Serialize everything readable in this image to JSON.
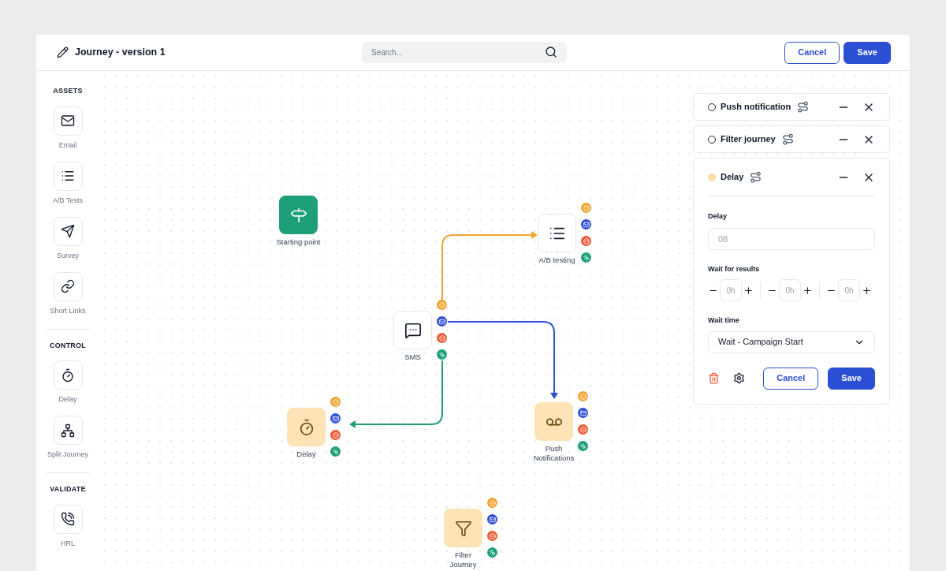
{
  "header": {
    "title": "Journey - version 1",
    "search": {
      "placeholder": "Search..."
    },
    "buttons": [
      {
        "label": "Cancel",
        "kind": "secondary"
      },
      {
        "label": "Save",
        "kind": "primary"
      }
    ]
  },
  "sidebar": {
    "sections": [
      {
        "title": "ASSETS",
        "items": [
          {
            "label": "Email"
          },
          {
            "label": "A/B Tests"
          },
          {
            "label": "Survey"
          },
          {
            "label": "Short Links"
          }
        ]
      },
      {
        "title": "CONTROL",
        "items": [
          {
            "label": "Delay"
          },
          {
            "label": "Split Journey"
          }
        ]
      },
      {
        "title": "VALIDATE",
        "items": [
          {
            "label": "HRL"
          }
        ]
      }
    ]
  },
  "canvas": {
    "nodes": [
      {
        "label": "Starting point",
        "kind": "start"
      },
      {
        "label": "A/B testing",
        "kind": "plain"
      },
      {
        "label": "SMS",
        "kind": "plain"
      },
      {
        "label": "Delay",
        "kind": "control"
      },
      {
        "label": "Push Notifications",
        "kind": "control"
      },
      {
        "label": "Filter Journey",
        "kind": "control"
      }
    ],
    "edges": [
      {
        "color": "#f0a530"
      },
      {
        "color": "#2d4fd6"
      },
      {
        "color": "#1f9e7a"
      }
    ]
  },
  "panel": {
    "cards": [
      {
        "title": "Push notification",
        "active": false,
        "expanded": false
      },
      {
        "title": "Filter journey",
        "active": false,
        "expanded": false
      },
      {
        "title": "Delay",
        "active": true,
        "expanded": true
      }
    ],
    "form": {
      "delay": {
        "label": "Delay",
        "placeholder": "08"
      },
      "wait_results": {
        "label": "Wait for results",
        "steppers": [
          {
            "placeholder": "0h"
          },
          {
            "placeholder": "0h"
          },
          {
            "placeholder": "0h"
          }
        ]
      },
      "wait_time": {
        "label": "Wait time",
        "value": "Wait - Campaign Start"
      },
      "buttons": [
        {
          "label": "Cancel",
          "kind": "secondary"
        },
        {
          "label": "Save",
          "kind": "primary"
        }
      ]
    }
  }
}
